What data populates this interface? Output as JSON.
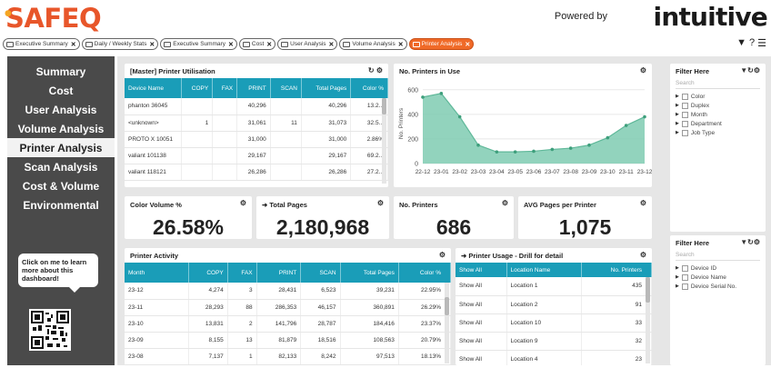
{
  "header": {
    "logo": "SAFEQ",
    "powered_by": "Powered by",
    "brand": "intuitive"
  },
  "tabs": [
    {
      "label": "Executive Summary"
    },
    {
      "label": "Daily / Weekly Stats"
    },
    {
      "label": "Executive Summary"
    },
    {
      "label": "Cost"
    },
    {
      "label": "User Analysis"
    },
    {
      "label": "Volume Analysis"
    },
    {
      "label": "Printer Analysis",
      "active": true
    }
  ],
  "nav": {
    "items": [
      "Summary",
      "Cost",
      "User Analysis",
      "Volume Analysis",
      "Printer Analysis",
      "Scan Analysis",
      "Cost & Volume",
      "Environmental"
    ],
    "active_index": 4,
    "promo_text": "Click on me to learn more about this dashboard!"
  },
  "utilisation": {
    "title": "[Master] Printer Utilisation",
    "columns": [
      "Device Name",
      "COPY",
      "FAX",
      "PRINT",
      "SCAN",
      "Total Pages",
      "Color %"
    ],
    "rows": [
      [
        "phanton 36045",
        "",
        "",
        "40,296",
        "",
        "40,296",
        "13.2..."
      ],
      [
        "<unknown>",
        "1",
        "",
        "31,061",
        "11",
        "31,073",
        "32.5..."
      ],
      [
        "PROTO X 10051",
        "",
        "",
        "31,000",
        "",
        "31,000",
        "2.86%"
      ],
      [
        "valiant 101138",
        "",
        "",
        "29,167",
        "",
        "29,167",
        "69.2..."
      ],
      [
        "valiant 118121",
        "",
        "",
        "26,286",
        "",
        "26,286",
        "27.2..."
      ]
    ]
  },
  "printers_chart": {
    "title": "No. Printers in Use"
  },
  "chart_data": {
    "type": "area",
    "title": "No. Printers in Use",
    "xlabel": "",
    "ylabel": "No. Printers",
    "x": [
      "22-12",
      "23-01",
      "23-02",
      "23-03",
      "23-04",
      "23-05",
      "23-06",
      "23-07",
      "23-08",
      "23-09",
      "23-10",
      "23-11",
      "23-12"
    ],
    "values": [
      540,
      570,
      380,
      150,
      95,
      95,
      100,
      115,
      125,
      150,
      210,
      310,
      380
    ],
    "ylim": [
      0,
      650
    ],
    "yticks": [
      0,
      200,
      400,
      600
    ],
    "color": "#7fcbb1",
    "grid": true
  },
  "kpis": [
    {
      "label": "Color Volume %",
      "value": "26.58%"
    },
    {
      "label": "Total Pages",
      "value": "2,180,968"
    },
    {
      "label": "No. Printers",
      "value": "686"
    },
    {
      "label": "AVG Pages per Printer",
      "value": "1,075"
    }
  ],
  "activity": {
    "title": "Printer Activity",
    "columns": [
      "Month",
      "COPY",
      "FAX",
      "PRINT",
      "SCAN",
      "Total Pages",
      "Color %"
    ],
    "rows": [
      [
        "23-12",
        "4,274",
        "3",
        "28,431",
        "6,523",
        "39,231",
        "22.95%"
      ],
      [
        "23-11",
        "28,293",
        "88",
        "286,353",
        "46,157",
        "360,891",
        "26.29%"
      ],
      [
        "23-10",
        "13,831",
        "2",
        "141,796",
        "28,787",
        "184,416",
        "23.37%"
      ],
      [
        "23-09",
        "8,155",
        "13",
        "81,879",
        "18,516",
        "108,563",
        "20.79%"
      ],
      [
        "23-08",
        "7,137",
        "1",
        "82,133",
        "8,242",
        "97,513",
        "18.13%"
      ]
    ]
  },
  "usage": {
    "title": "Printer Usage - Drill for detail",
    "columns": [
      "Show All",
      "Location Name",
      "No. Printers"
    ],
    "rows": [
      [
        "Show All",
        "Location 1",
        "435"
      ],
      [
        "Show All",
        "Location 2",
        "91"
      ],
      [
        "Show All",
        "Location 10",
        "33"
      ],
      [
        "Show All",
        "Location 9",
        "32"
      ],
      [
        "Show All",
        "Location 4",
        "23"
      ]
    ]
  },
  "filter1": {
    "title": "Filter Here",
    "search_placeholder": "Search",
    "items": [
      "Color",
      "Duplex",
      "Month",
      "Department",
      "Job Type"
    ]
  },
  "filter2": {
    "title": "Filter Here",
    "search_placeholder": "Search",
    "items": [
      "Device ID",
      "Device Name",
      "Device Serial No."
    ]
  },
  "colors": {
    "accent_orange": "#f06a28",
    "header_teal": "#1a9db8",
    "nav_dark": "#4a4a4a",
    "area_green": "#7fcbb1"
  }
}
